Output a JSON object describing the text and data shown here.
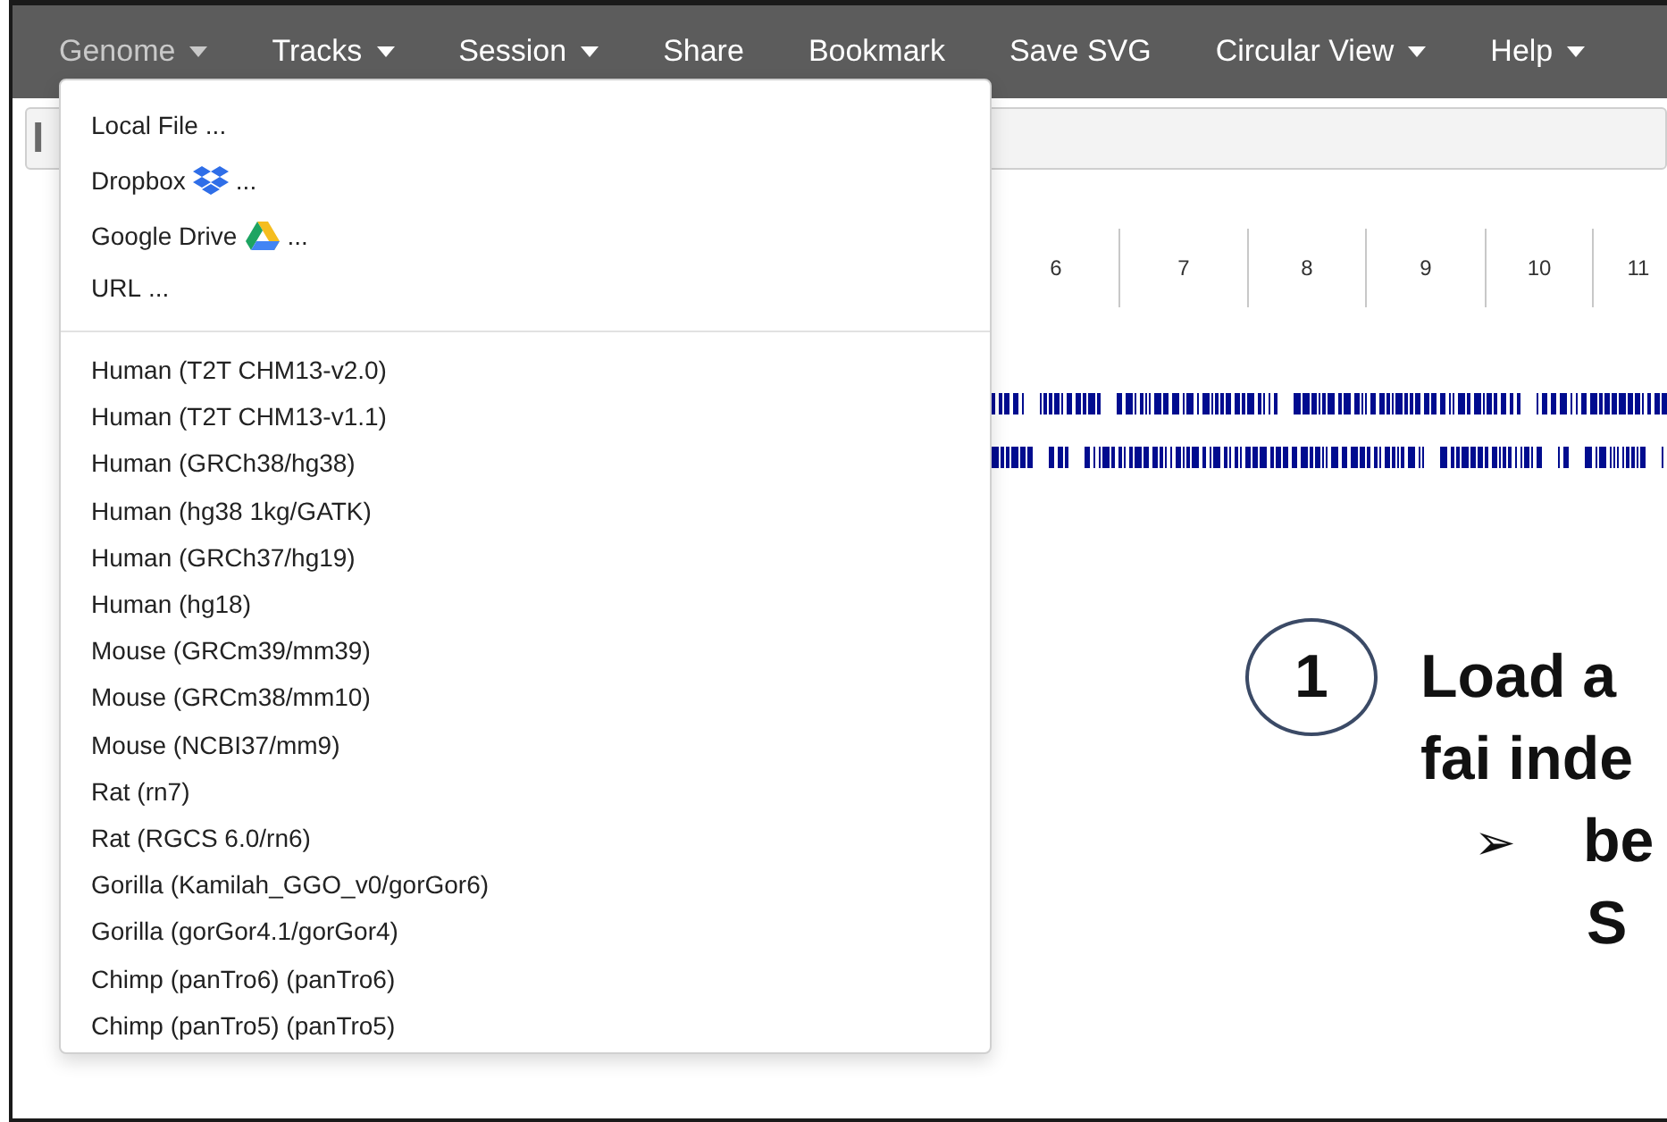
{
  "navbar": {
    "items": [
      {
        "label": "Genome",
        "caret": true,
        "selected": true
      },
      {
        "label": "Tracks",
        "caret": true,
        "selected": false
      },
      {
        "label": "Session",
        "caret": true,
        "selected": false
      },
      {
        "label": "Share",
        "caret": false,
        "selected": false
      },
      {
        "label": "Bookmark",
        "caret": false,
        "selected": false
      },
      {
        "label": "Save SVG",
        "caret": false,
        "selected": false
      },
      {
        "label": "Circular View",
        "caret": true,
        "selected": false
      },
      {
        "label": "Help",
        "caret": true,
        "selected": false
      }
    ]
  },
  "toolbar": {
    "text": "I"
  },
  "ruler": {
    "labels": [
      "6",
      "7",
      "8",
      "9",
      "10",
      "11"
    ]
  },
  "genome_menu": {
    "sections": [
      [
        {
          "kind": "plain",
          "label": "Local File",
          "suffix": "..."
        },
        {
          "kind": "dropbox",
          "label": "Dropbox",
          "suffix": "..."
        },
        {
          "kind": "drive",
          "label": "Google Drive",
          "suffix": "..."
        },
        {
          "kind": "plain",
          "label": "URL",
          "suffix": "..."
        }
      ],
      [
        {
          "kind": "plain",
          "label": "Human (T2T CHM13-v2.0)"
        },
        {
          "kind": "plain",
          "label": "Human (T2T CHM13-v1.1)"
        },
        {
          "kind": "plain",
          "label": "Human (GRCh38/hg38)"
        },
        {
          "kind": "plain",
          "label": "Human (hg38 1kg/GATK)"
        },
        {
          "kind": "plain",
          "label": "Human (GRCh37/hg19)"
        },
        {
          "kind": "plain",
          "label": "Human (hg18)"
        },
        {
          "kind": "plain",
          "label": "Mouse (GRCm39/mm39)"
        },
        {
          "kind": "plain",
          "label": "Mouse (GRCm38/mm10)"
        },
        {
          "kind": "plain",
          "label": "Mouse (NCBI37/mm9)"
        },
        {
          "kind": "plain",
          "label": "Rat (rn7)"
        },
        {
          "kind": "plain",
          "label": "Rat (RGCS 6.0/rn6)"
        },
        {
          "kind": "plain",
          "label": "Gorilla (Kamilah_GGO_v0/gorGor6)"
        },
        {
          "kind": "plain",
          "label": "Gorilla (gorGor4.1/gorGor4)"
        },
        {
          "kind": "plain",
          "label": "Chimp (panTro6) (panTro6)"
        },
        {
          "kind": "plain",
          "label": "Chimp (panTro5) (panTro5)"
        }
      ]
    ]
  },
  "annotation": {
    "number": "1",
    "lines": [
      {
        "kind": "heading",
        "text": "Load a"
      },
      {
        "kind": "heading",
        "text": "fai inde"
      },
      {
        "kind": "bullet",
        "bullet": "➢",
        "text": "be"
      },
      {
        "kind": "continuation",
        "text": "S"
      }
    ]
  }
}
